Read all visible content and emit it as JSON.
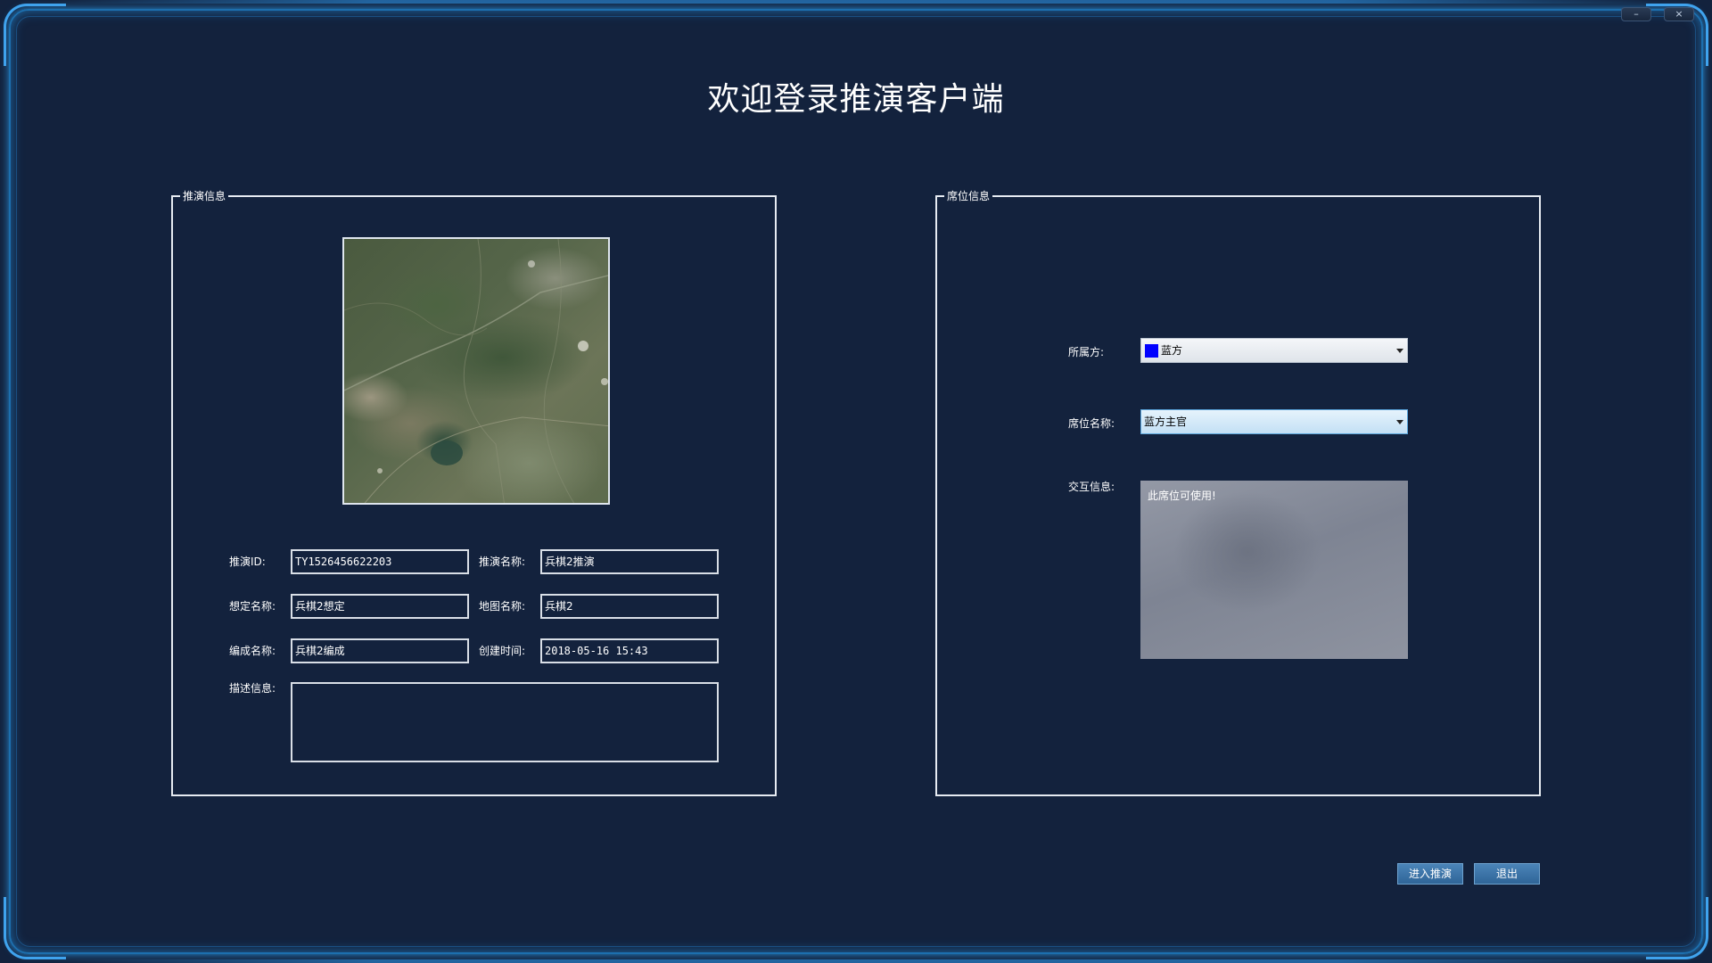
{
  "window": {
    "title": "欢迎登录推演客户端",
    "minimize_symbol": "–",
    "close_symbol": "×"
  },
  "left_panel": {
    "title": "推演信息",
    "fields": {
      "deduction_id_label": "推演ID:",
      "deduction_id_value": "TY1526456622203",
      "deduction_name_label": "推演名称:",
      "deduction_name_value": "兵棋2推演",
      "scenario_name_label": "想定名称:",
      "scenario_name_value": "兵棋2想定",
      "map_name_label": "地图名称:",
      "map_name_value": "兵棋2",
      "formation_name_label": "编成名称:",
      "formation_name_value": "兵棋2编成",
      "created_time_label": "创建时间:",
      "created_time_value": "2018-05-16 15:43",
      "description_label": "描述信息:",
      "description_value": ""
    }
  },
  "right_panel": {
    "title": "席位信息",
    "side_label": "所属方:",
    "side_value": "蓝方",
    "side_color": "#0000ff",
    "seat_label": "席位名称:",
    "seat_value": "蓝方主官",
    "interaction_label": "交互信息:",
    "interaction_message": "此席位可使用!"
  },
  "buttons": {
    "enter_label": "进入推演",
    "exit_label": "退出"
  }
}
